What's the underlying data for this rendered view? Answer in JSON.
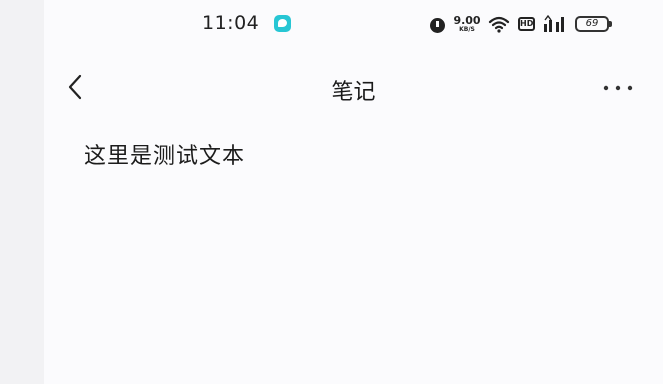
{
  "status_bar": {
    "time": "11:04",
    "net_speed_value": "9.00",
    "net_speed_unit": "KB/S",
    "hd_label": "HD",
    "battery_level": "69",
    "icons": [
      "notification-app-icon",
      "alarm-icon",
      "wifi-icon",
      "hd-icon",
      "signal-icon",
      "battery-icon"
    ]
  },
  "header": {
    "title": "笔记",
    "back_icon": "chevron-left-icon",
    "more_icon": "more-horizontal-icon"
  },
  "note": {
    "body": "这里是测试文本"
  }
}
